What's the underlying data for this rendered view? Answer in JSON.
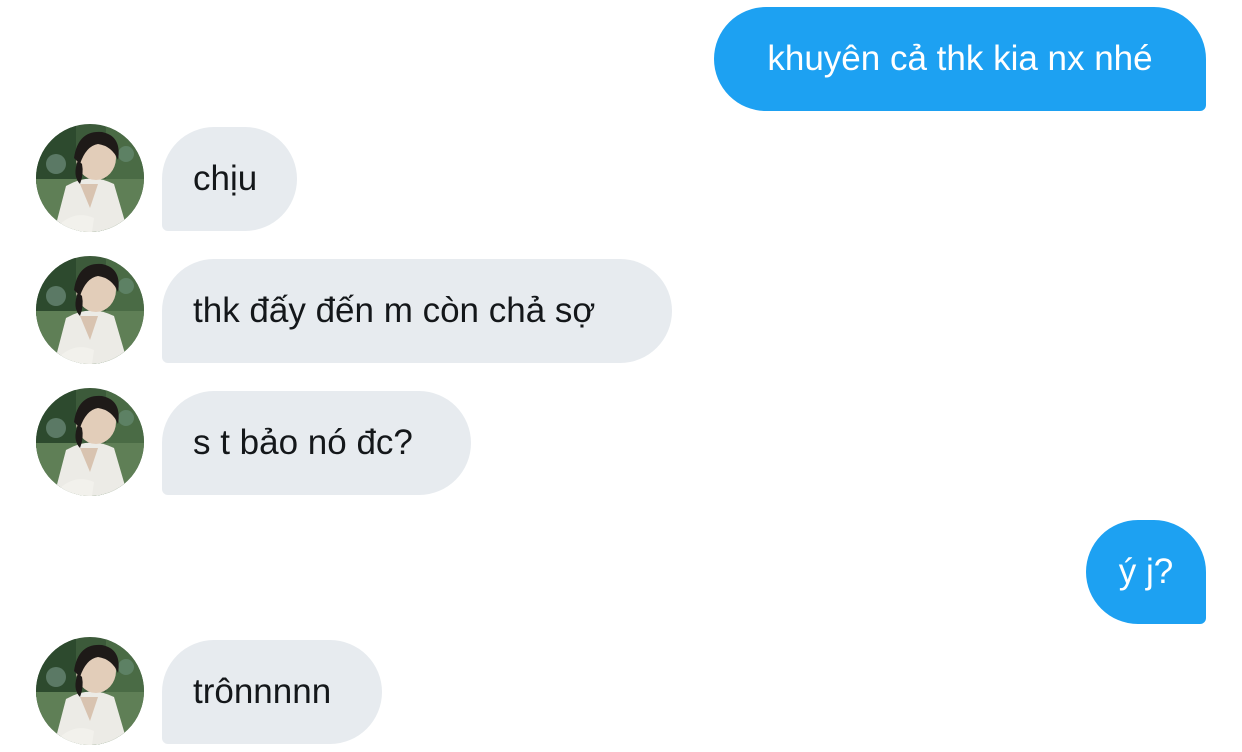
{
  "conversation": {
    "messages": [
      {
        "direction": "outgoing",
        "text": "khuyên cả thk kia nx nhé"
      },
      {
        "direction": "incoming",
        "text": "chịu",
        "avatar": "user-avatar"
      },
      {
        "direction": "incoming",
        "text": "thk đấy đến m còn chả sợ",
        "avatar": "user-avatar"
      },
      {
        "direction": "incoming",
        "text": "s t bảo nó đc?",
        "avatar": "user-avatar"
      },
      {
        "direction": "outgoing",
        "text": "ý j?"
      },
      {
        "direction": "incoming",
        "text": "trônnnnn",
        "avatar": "user-avatar"
      }
    ]
  },
  "colors": {
    "outgoing_bubble": "#1da1f2",
    "incoming_bubble": "#e7ebef",
    "incoming_text": "#14171a",
    "background": "#ffffff"
  }
}
